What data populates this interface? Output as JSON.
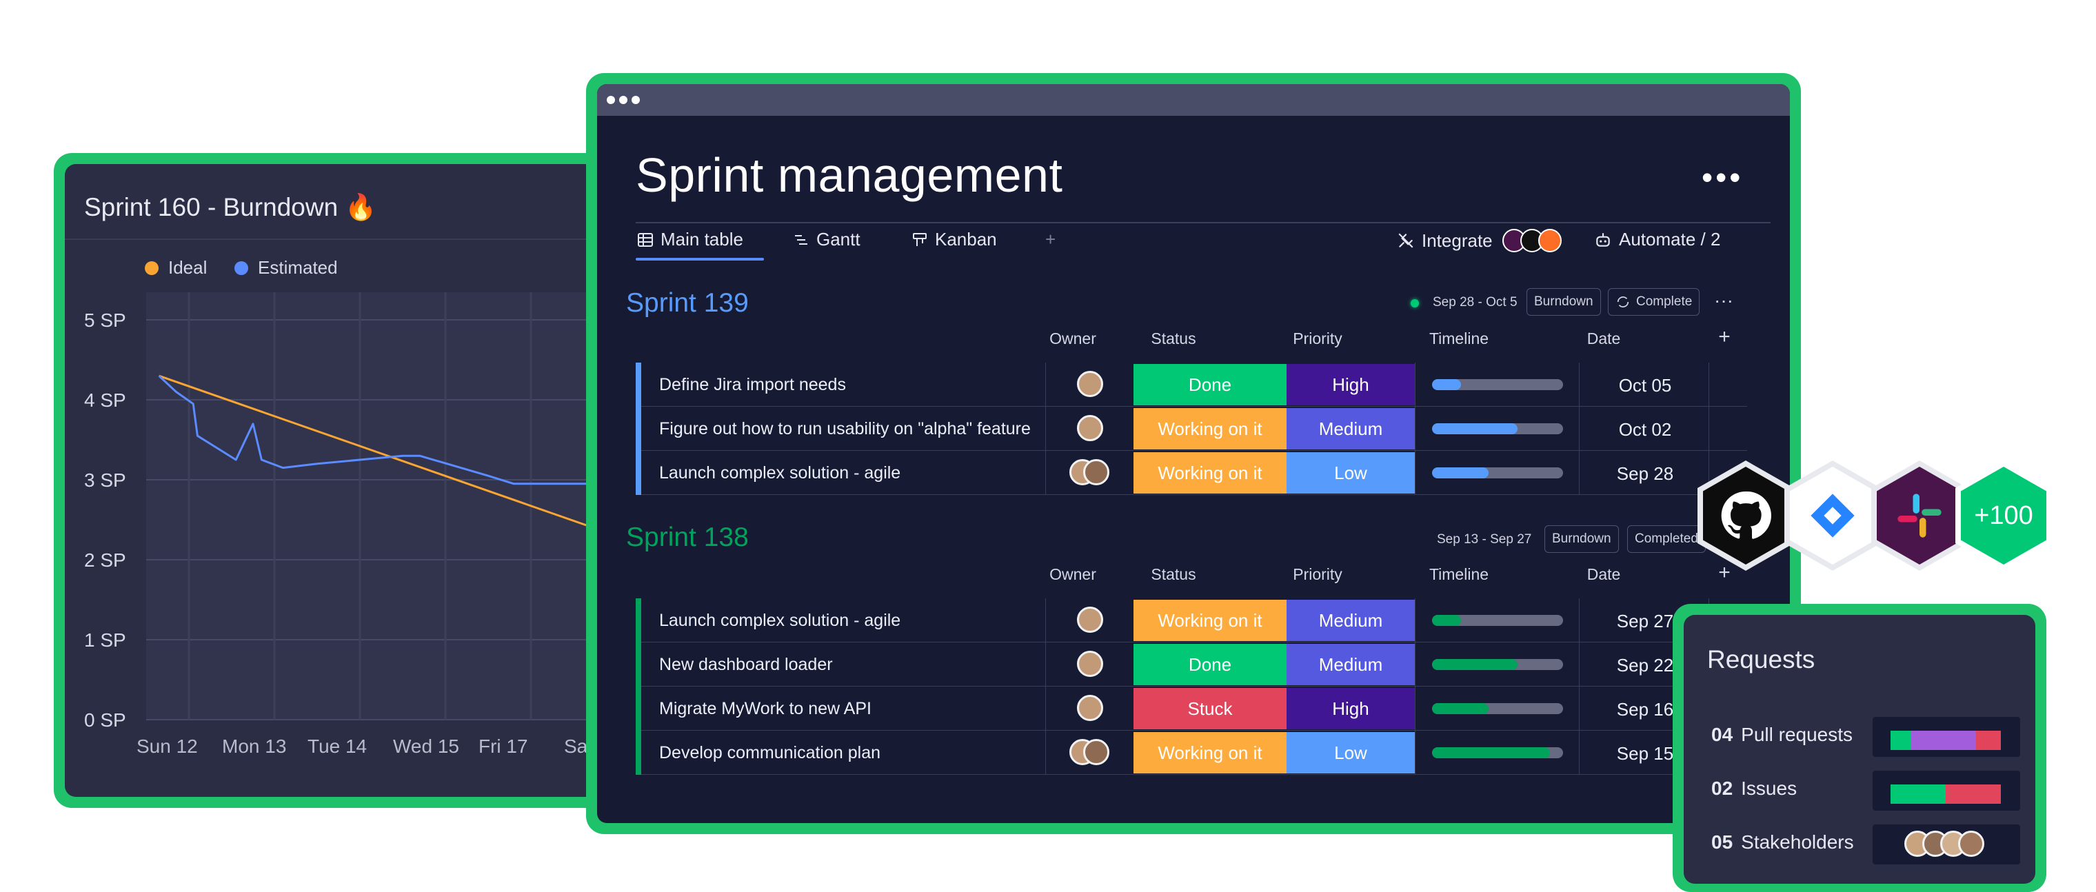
{
  "burndown": {
    "title": "Sprint 160 - Burndown 🔥",
    "legend": [
      {
        "label": "Ideal",
        "color": "#f9a533"
      },
      {
        "label": "Estimated",
        "color": "#5b8cff"
      }
    ]
  },
  "chart_data": {
    "type": "line",
    "title": "Sprint 160 - Burndown 🔥",
    "y_tick_labels": [
      "5 SP",
      "4 SP",
      "3 SP",
      "2 SP",
      "1 SP",
      "0 SP"
    ],
    "x_tick_labels": [
      "Sun 12",
      "Mon 13",
      "Tue 14",
      "Wed 15",
      "Fri 17",
      "Sa"
    ],
    "ylim": [
      0,
      5
    ],
    "grid": true,
    "legend_position": "top-left",
    "series": [
      {
        "name": "Ideal",
        "color": "#f9a533",
        "x": [
          0.15,
          5.5
        ],
        "y": [
          4.3,
          2.3
        ]
      },
      {
        "name": "Estimated",
        "color": "#5b8cff",
        "x": [
          0.15,
          0.35,
          0.55,
          0.6,
          1.05,
          1.25,
          1.35,
          1.6,
          2.0,
          2.5,
          3.0,
          3.2,
          4.0,
          4.3,
          5.5
        ],
        "y": [
          4.3,
          4.1,
          3.95,
          3.55,
          3.25,
          3.7,
          3.25,
          3.15,
          3.2,
          3.25,
          3.3,
          3.3,
          3.05,
          2.95,
          2.95
        ]
      }
    ]
  },
  "main": {
    "title": "Sprint management",
    "more": "•••",
    "tabs": [
      {
        "label": "Main table",
        "icon": "table-icon"
      },
      {
        "label": "Gantt",
        "icon": "gantt-icon"
      },
      {
        "label": "Kanban",
        "icon": "kanban-icon"
      }
    ],
    "add_tab": "+",
    "integrate": "Integrate",
    "automate": "Automate / 2",
    "columns": {
      "owner": "Owner",
      "status": "Status",
      "priority": "Priority",
      "timeline": "Timeline",
      "date": "Date",
      "add": "+"
    },
    "groups": [
      {
        "title": "Sprint 139",
        "color": "#579bfc",
        "range": "Sep 28 - Oct 5",
        "burndown_btn": "Burndown",
        "complete_btn": "Complete",
        "more": "···",
        "rows": [
          {
            "name": "Define Jira import needs",
            "status": "Done",
            "status_color": "#00c875",
            "priority": "High",
            "priority_color": "#401694",
            "timeline": 0.22,
            "date": "Oct 05",
            "avatars": 1
          },
          {
            "name": "Figure out how to run usability on \"alpha\" feature",
            "status": "Working on it",
            "status_color": "#fdab3d",
            "priority": "Medium",
            "priority_color": "#5559df",
            "timeline": 0.65,
            "date": "Oct 02",
            "avatars": 1
          },
          {
            "name": "Launch complex solution - agile",
            "status": "Working on it",
            "status_color": "#fdab3d",
            "priority": "Low",
            "priority_color": "#579bfc",
            "timeline": 0.43,
            "date": "Sep 28",
            "avatars": 2
          }
        ]
      },
      {
        "title": "Sprint 138",
        "color": "#00a35c",
        "range": "Sep 13 - Sep 27",
        "burndown_btn": "Burndown",
        "complete_btn": "Completed",
        "rows": [
          {
            "name": "Launch complex solution - agile",
            "status": "Working on it",
            "status_color": "#fdab3d",
            "priority": "Medium",
            "priority_color": "#5559df",
            "timeline": 0.22,
            "date": "Sep 27",
            "avatars": 1
          },
          {
            "name": "New dashboard loader",
            "status": "Done",
            "status_color": "#00c875",
            "priority": "Medium",
            "priority_color": "#5559df",
            "timeline": 0.65,
            "date": "Sep 22",
            "avatars": 1
          },
          {
            "name": "Migrate MyWork to new API",
            "status": "Stuck",
            "status_color": "#e2445c",
            "priority": "High",
            "priority_color": "#401694",
            "timeline": 0.43,
            "date": "Sep 16",
            "avatars": 1
          },
          {
            "name": "Develop communication plan",
            "status": "Working on it",
            "status_color": "#fdab3d",
            "priority": "Low",
            "priority_color": "#579bfc",
            "timeline": 0.9,
            "date": "Sep 15",
            "avatars": 2
          }
        ]
      }
    ]
  },
  "integrations": {
    "icons": [
      "github-icon",
      "jira-icon",
      "slack-icon"
    ],
    "more": "+100"
  },
  "requests": {
    "title": "Requests",
    "items": [
      {
        "num": "04",
        "label": "Pull requests"
      },
      {
        "num": "02",
        "label": "Issues"
      },
      {
        "num": "05",
        "label": "Stakeholders"
      }
    ]
  }
}
